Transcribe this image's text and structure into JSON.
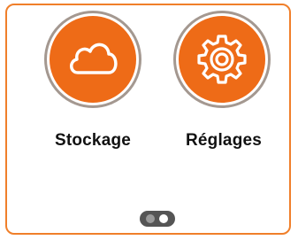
{
  "apps": [
    {
      "label": "Stockage",
      "icon": "cloud-icon"
    },
    {
      "label": "Réglages",
      "icon": "gear-icon"
    }
  ],
  "pager": {
    "page_count": 2,
    "active_page": 2
  },
  "colors": {
    "accent": "#ee6b17",
    "border": "#f07f2a",
    "ring": "#a49890",
    "pager_bg": "#555555"
  }
}
